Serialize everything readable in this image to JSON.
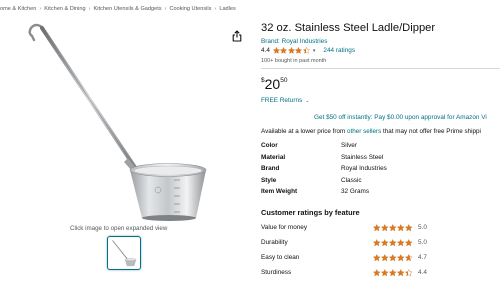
{
  "breadcrumb": [
    "ome & Kitchen",
    "Kitchen & Dining",
    "Kitchen Utensils & Gadgets",
    "Cooking Utensils",
    "Ladles"
  ],
  "breadcrumb_separator": "›",
  "image_caption": "Click image to open expanded view",
  "product": {
    "title": "32 oz. Stainless Steel Ladle/Dipper",
    "brand_link": "Brand: Royal Industries",
    "rating": "4.4",
    "rating_value": 4.4,
    "ratings_count": "244 ratings",
    "bought": "100+ bought in past month",
    "price_symbol": "$",
    "price_whole": "20",
    "price_fraction": "50",
    "returns": "FREE Returns",
    "offer": "Get $50 off instantly: Pay $0.00 upon approval for Amazon Vi",
    "lower_price_prefix": "Available at a lower price from",
    "lower_price_link": "other sellers",
    "lower_price_suffix": "that may not offer free Prime shippi"
  },
  "specs": [
    {
      "key": "Color",
      "value": "Silver"
    },
    {
      "key": "Material",
      "value": "Stainless Steel"
    },
    {
      "key": "Brand",
      "value": "Royal Industries"
    },
    {
      "key": "Style",
      "value": "Classic"
    },
    {
      "key": "Item Weight",
      "value": "32 Grams"
    }
  ],
  "feature_ratings": {
    "heading": "Customer ratings by feature",
    "items": [
      {
        "name": "Value for money",
        "score": "5.0",
        "stars": 5.0
      },
      {
        "name": "Durability",
        "score": "5.0",
        "stars": 5.0
      },
      {
        "name": "Easy to clean",
        "score": "4.7",
        "stars": 4.7
      },
      {
        "name": "Sturdiness",
        "score": "4.4",
        "stars": 4.4
      }
    ]
  },
  "icons": {
    "share": "share-icon",
    "star": "star-icon",
    "caret": "chevron-down-icon"
  },
  "colors": {
    "link": "#007185",
    "star": "#de7921",
    "text": "#0f1111",
    "muted": "#565959"
  }
}
